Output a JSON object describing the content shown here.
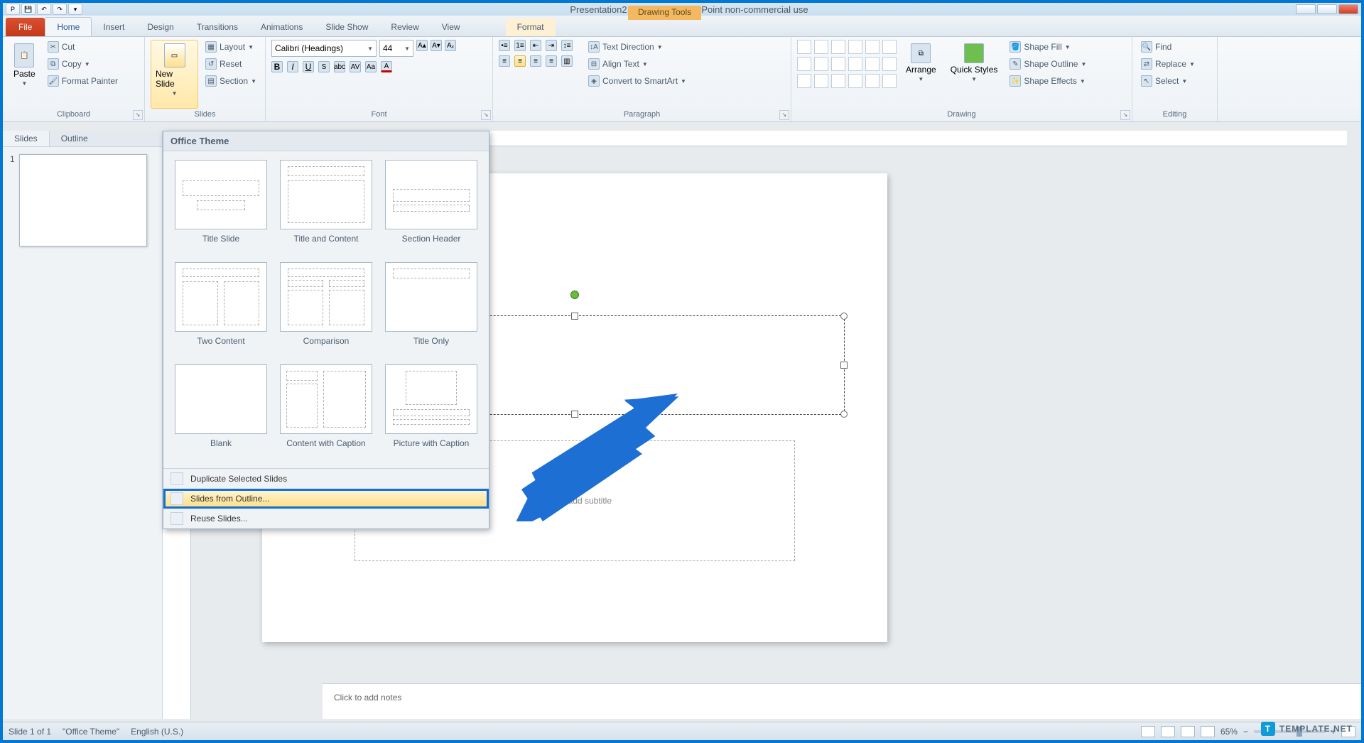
{
  "window": {
    "title": "Presentation2 - Microsoft PowerPoint non-commercial use",
    "context_tools": "Drawing Tools"
  },
  "tabs": {
    "file": "File",
    "items": [
      "Home",
      "Insert",
      "Design",
      "Transitions",
      "Animations",
      "Slide Show",
      "Review",
      "View"
    ],
    "context": "Format"
  },
  "clipboard": {
    "paste": "Paste",
    "cut": "Cut",
    "copy": "Copy",
    "format_painter": "Format Painter",
    "group_label": "Clipboard"
  },
  "slides_group": {
    "new_slide": "New Slide",
    "layout": "Layout",
    "reset": "Reset",
    "section": "Section"
  },
  "font_group": {
    "name": "Calibri (Headings)",
    "size": "44"
  },
  "paragraph_group": {
    "text_direction": "Text Direction",
    "align_text": "Align Text",
    "convert_smartart": "Convert to SmartArt",
    "label": "Paragraph"
  },
  "drawing_group": {
    "arrange": "Arrange",
    "quick_styles": "Quick Styles",
    "shape_fill": "Shape Fill",
    "shape_outline": "Shape Outline",
    "shape_effects": "Shape Effects",
    "label": "Drawing"
  },
  "editing_group": {
    "find": "Find",
    "replace": "Replace",
    "select": "Select",
    "label": "Editing"
  },
  "panel": {
    "slides_tab": "Slides",
    "outline_tab": "Outline",
    "thumb_num": "1"
  },
  "gallery": {
    "header": "Office Theme",
    "layouts": [
      "Title Slide",
      "Title and Content",
      "Section Header",
      "Two Content",
      "Comparison",
      "Title Only",
      "Blank",
      "Content with Caption",
      "Picture with Caption"
    ],
    "menu": {
      "duplicate": "Duplicate Selected Slides",
      "from_outline": "Slides from Outline...",
      "reuse": "Reuse Slides..."
    }
  },
  "canvas": {
    "subtitle_placeholder": "Click to add subtitle"
  },
  "notes": {
    "placeholder": "Click to add notes"
  },
  "status": {
    "slide_info": "Slide 1 of 1",
    "theme": "\"Office Theme\"",
    "language": "English (U.S.)",
    "zoom": "65%"
  },
  "watermark": {
    "brand": "TEMPLATE.NET"
  }
}
